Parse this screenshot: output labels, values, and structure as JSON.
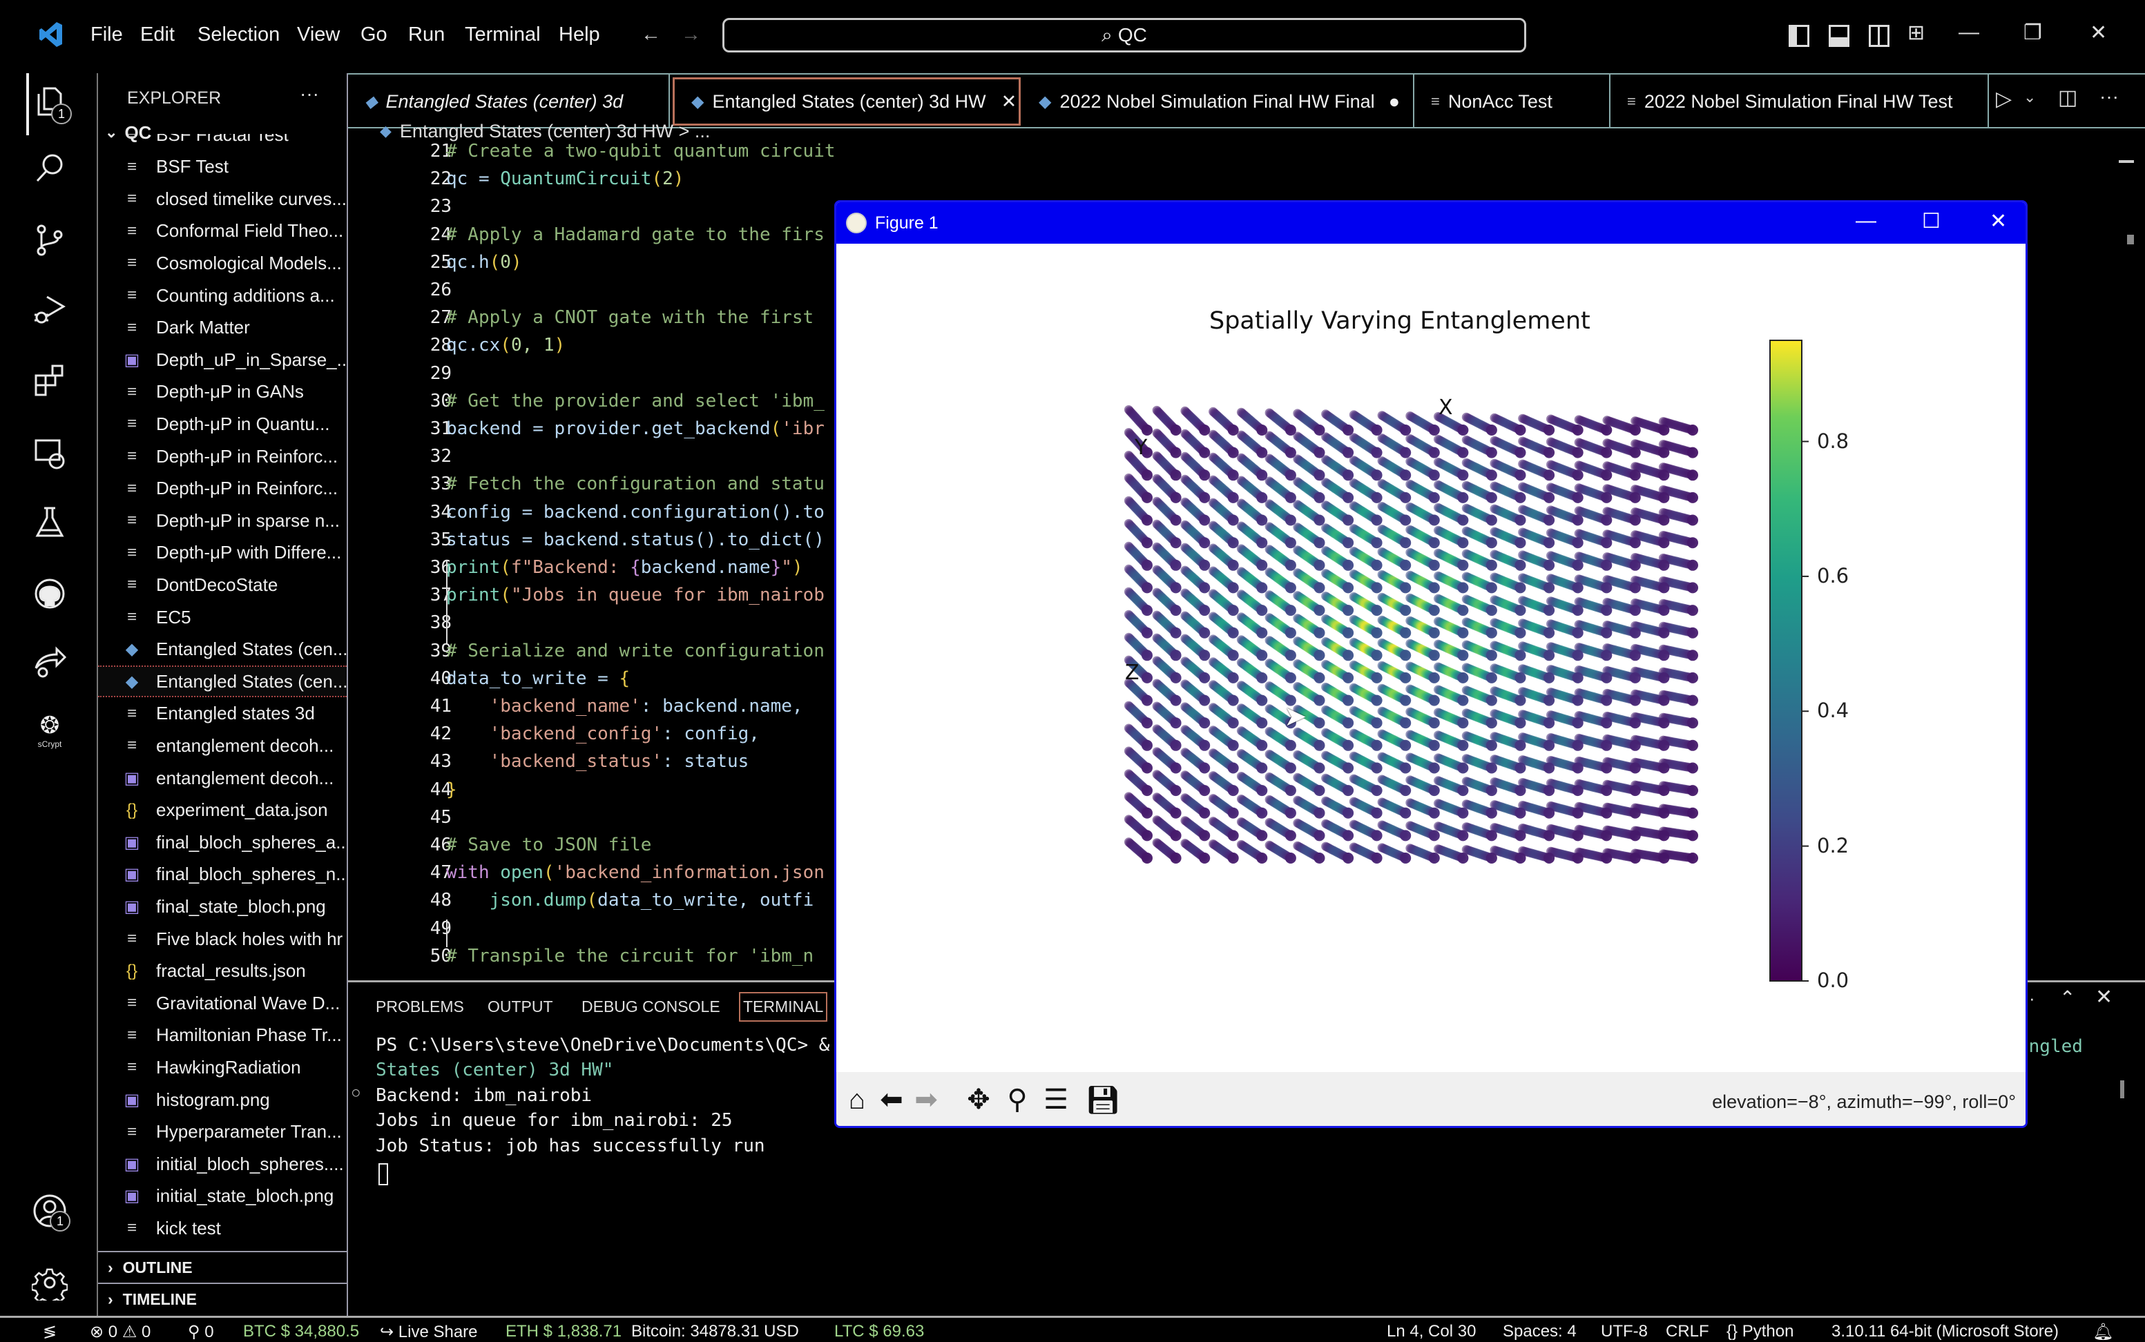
{
  "titlebar": {
    "menu": [
      "File",
      "Edit",
      "Selection",
      "View",
      "Go",
      "Run",
      "Terminal",
      "Help"
    ],
    "search": "QC",
    "back_icon": "arrow-left-icon",
    "forward_icon": "arrow-right-icon"
  },
  "activity_bar": {
    "items": [
      {
        "name": "explorer",
        "icon": "files-icon",
        "badge": "1"
      },
      {
        "name": "search",
        "icon": "search-icon"
      },
      {
        "name": "source-control",
        "icon": "source-control-icon"
      },
      {
        "name": "run-debug",
        "icon": "debug-icon"
      },
      {
        "name": "extensions",
        "icon": "extensions-icon"
      },
      {
        "name": "remote-explorer",
        "icon": "remote-icon"
      },
      {
        "name": "testing",
        "icon": "flask-icon"
      },
      {
        "name": "github",
        "icon": "github-icon"
      },
      {
        "name": "live-share",
        "icon": "share-icon"
      },
      {
        "name": "scrypt",
        "icon": "scrypt-icon",
        "label": "sCrypt"
      }
    ],
    "accounts_badge": "1"
  },
  "sidebar": {
    "title": "EXPLORER",
    "more": "···",
    "folder": "QC",
    "files": [
      {
        "name": "BSF Fractal Test",
        "type": "text"
      },
      {
        "name": "BSF Test",
        "type": "text"
      },
      {
        "name": "closed timelike curves...",
        "type": "text"
      },
      {
        "name": "Conformal Field Theo...",
        "type": "text"
      },
      {
        "name": "Cosmological Models...",
        "type": "text"
      },
      {
        "name": "Counting additions a...",
        "type": "text"
      },
      {
        "name": "Dark Matter",
        "type": "text"
      },
      {
        "name": "Depth_uP_in_Sparse_...",
        "type": "image"
      },
      {
        "name": "Depth-μP in GANs",
        "type": "text"
      },
      {
        "name": "Depth-μP in Quantu...",
        "type": "text"
      },
      {
        "name": "Depth-μP in Reinforc...",
        "type": "text"
      },
      {
        "name": "Depth-μP in Reinforc...",
        "type": "text"
      },
      {
        "name": "Depth-μP in sparse n...",
        "type": "text"
      },
      {
        "name": "Depth-μP with Differe...",
        "type": "text"
      },
      {
        "name": "DontDecoState",
        "type": "text"
      },
      {
        "name": "EC5",
        "type": "text"
      },
      {
        "name": "Entangled States (cen...",
        "type": "python"
      },
      {
        "name": "Entangled States (cen...",
        "type": "python",
        "selected": true
      },
      {
        "name": "Entangled states 3d",
        "type": "text"
      },
      {
        "name": "entanglement decoh...",
        "type": "text"
      },
      {
        "name": "entanglement decoh...",
        "type": "image"
      },
      {
        "name": "experiment_data.json",
        "type": "json"
      },
      {
        "name": "final_bloch_spheres_a...",
        "type": "image"
      },
      {
        "name": "final_bloch_spheres_n...",
        "type": "image"
      },
      {
        "name": "final_state_bloch.png",
        "type": "image"
      },
      {
        "name": "Five black holes with hr",
        "type": "text"
      },
      {
        "name": "fractal_results.json",
        "type": "json"
      },
      {
        "name": "Gravitational Wave D...",
        "type": "text"
      },
      {
        "name": "Hamiltonian Phase Tr...",
        "type": "text"
      },
      {
        "name": "HawkingRadiation",
        "type": "text"
      },
      {
        "name": "histogram.png",
        "type": "image"
      },
      {
        "name": "Hyperparameter Tran...",
        "type": "text"
      },
      {
        "name": "initial_bloch_spheres....",
        "type": "image"
      },
      {
        "name": "initial_state_bloch.png",
        "type": "image"
      },
      {
        "name": "kick test",
        "type": "text"
      }
    ],
    "outline": "OUTLINE",
    "timeline": "TIMELINE"
  },
  "tabs": [
    {
      "label": "Entangled States (center) 3d",
      "icon": "python",
      "italic": true
    },
    {
      "label": "Entangled States (center) 3d HW",
      "icon": "python",
      "active": true,
      "close": "✕"
    },
    {
      "label": "2022 Nobel Simulation Final HW Final",
      "icon": "python",
      "dirty": "●"
    },
    {
      "label": "NonAcc Test",
      "icon": "text"
    },
    {
      "label": "2022 Nobel Simulation Final HW Test",
      "icon": "text"
    }
  ],
  "breadcrumb": "Entangled States (center) 3d HW > ...",
  "code": [
    {
      "n": "21",
      "parts": [
        [
          "c-com",
          "# Create a two-qubit quantum circuit"
        ]
      ]
    },
    {
      "n": "22",
      "parts": [
        [
          "c-var",
          "qc = "
        ],
        [
          "c-fn",
          "QuantumCircuit"
        ],
        [
          "c-par",
          "("
        ],
        [
          "c-num",
          "2"
        ],
        [
          "c-par",
          ")"
        ]
      ]
    },
    {
      "n": "23",
      "parts": []
    },
    {
      "n": "24",
      "parts": [
        [
          "c-com",
          "# Apply a Hadamard gate to the firs"
        ]
      ]
    },
    {
      "n": "25",
      "parts": [
        [
          "c-var",
          "qc.h"
        ],
        [
          "c-par",
          "("
        ],
        [
          "c-num",
          "0"
        ],
        [
          "c-par",
          ")"
        ]
      ]
    },
    {
      "n": "26",
      "parts": []
    },
    {
      "n": "27",
      "parts": [
        [
          "c-com",
          "# Apply a CNOT gate with the first "
        ]
      ]
    },
    {
      "n": "28",
      "parts": [
        [
          "c-var",
          "qc.cx"
        ],
        [
          "c-par",
          "("
        ],
        [
          "c-num",
          "0, 1"
        ],
        [
          "c-par",
          ")"
        ]
      ]
    },
    {
      "n": "29",
      "parts": []
    },
    {
      "n": "30",
      "parts": [
        [
          "c-com",
          "# Get the provider and select 'ibm_"
        ]
      ]
    },
    {
      "n": "31",
      "parts": [
        [
          "c-var",
          "backend = provider.get_backend"
        ],
        [
          "c-par",
          "("
        ],
        [
          "c-str",
          "'ibr"
        ]
      ]
    },
    {
      "n": "32",
      "parts": []
    },
    {
      "n": "33",
      "parts": [
        [
          "c-com",
          "# Fetch the configuration and statu"
        ]
      ]
    },
    {
      "n": "34",
      "parts": [
        [
          "c-var",
          "config = backend.configuration().to"
        ]
      ]
    },
    {
      "n": "35",
      "parts": [
        [
          "c-var",
          "status = backend.status().to_dict()"
        ]
      ]
    },
    {
      "n": "36",
      "parts": [
        [
          "c-fn",
          "print"
        ],
        [
          "c-par",
          "("
        ],
        [
          "c-str",
          "f\"Backend: "
        ],
        [
          "c-kw",
          "{"
        ],
        [
          "c-var",
          "backend.name"
        ],
        [
          "c-kw",
          "}"
        ],
        [
          "c-str",
          "\""
        ],
        [
          "c-par",
          ")"
        ]
      ]
    },
    {
      "n": "37",
      "parts": [
        [
          "c-fn",
          "print"
        ],
        [
          "c-par",
          "("
        ],
        [
          "c-str",
          "\"Jobs in queue for ibm_nairob"
        ]
      ]
    },
    {
      "n": "38",
      "parts": []
    },
    {
      "n": "39",
      "parts": [
        [
          "c-com",
          "# Serialize and write configuration"
        ]
      ]
    },
    {
      "n": "40",
      "parts": [
        [
          "c-var",
          "data_to_write = "
        ],
        [
          "c-par",
          "{"
        ]
      ]
    },
    {
      "n": "41",
      "parts": [
        [
          "c-var",
          "    "
        ],
        [
          "c-str",
          "'backend_name'"
        ],
        [
          "c-var",
          ": backend.name,"
        ]
      ]
    },
    {
      "n": "42",
      "parts": [
        [
          "c-var",
          "    "
        ],
        [
          "c-str",
          "'backend_config'"
        ],
        [
          "c-var",
          ": config,"
        ]
      ]
    },
    {
      "n": "43",
      "parts": [
        [
          "c-var",
          "    "
        ],
        [
          "c-str",
          "'backend_status'"
        ],
        [
          "c-var",
          ": status"
        ]
      ]
    },
    {
      "n": "44",
      "parts": [
        [
          "c-par",
          "}"
        ]
      ]
    },
    {
      "n": "45",
      "parts": []
    },
    {
      "n": "46",
      "parts": [
        [
          "c-com",
          "# Save to JSON file"
        ]
      ]
    },
    {
      "n": "47",
      "parts": [
        [
          "c-kw",
          "with "
        ],
        [
          "c-fn",
          "open"
        ],
        [
          "c-par",
          "("
        ],
        [
          "c-str",
          "'backend_information.json"
        ]
      ]
    },
    {
      "n": "48",
      "parts": [
        [
          "c-var",
          "    "
        ],
        [
          "c-fn",
          "json.dump"
        ],
        [
          "c-par",
          "("
        ],
        [
          "c-var",
          "data_to_write, outfi"
        ]
      ]
    },
    {
      "n": "49",
      "parts": []
    },
    {
      "n": "50",
      "parts": [
        [
          "c-com",
          "# Transpile the circuit for 'ibm_n"
        ]
      ]
    }
  ],
  "panel": {
    "tabs": [
      "PROBLEMS",
      "OUTPUT",
      "DEBUG CONSOLE",
      "TERMINAL"
    ],
    "active_tab": "TERMINAL",
    "terminal": [
      {
        "text": "PS C:\\Users\\steve\\OneDrive\\Documents\\QC> &",
        "color": "#eeeeee"
      },
      {
        "text": "States (center) 3d HW\"",
        "color": "#7fc8b0"
      },
      {
        "text": "Backend: ibm_nairobi",
        "color": "#eeeeee",
        "marker": "○"
      },
      {
        "text": "Jobs in queue for ibm_nairobi: 25",
        "color": "#eeeeee"
      },
      {
        "text": "Job Status: job has successfully run",
        "color": "#eeeeee"
      }
    ],
    "terminal_right_text": "angled"
  },
  "statusbar": {
    "remote": "≶",
    "errors": "0",
    "warnings": "0",
    "ports": "0",
    "btc": "BTC $ 34,880.5",
    "live_share": "Live Share",
    "eth": "ETH $ 1,838.71",
    "bitcoin": "Bitcoin: 34878.31 USD",
    "ltc": "LTC $ 69.63",
    "position": "Ln 4, Col 30",
    "spaces": "Spaces: 4",
    "encoding": "UTF-8",
    "eol": "CRLF",
    "language": "Python",
    "interpreter": "3.10.11 64-bit (Microsoft Store)"
  },
  "figure": {
    "window_title": "Figure 1",
    "coords": "elevation=−8°, azimuth=−99°, roll=0°",
    "toolbar": [
      "home",
      "back",
      "forward",
      "pan",
      "zoom",
      "configure",
      "save"
    ]
  },
  "chart_data": {
    "type": "scatter",
    "projection": "3d",
    "title": "Spatially Varying Entanglement",
    "xlabel": "X",
    "ylabel": "Y",
    "zlabel": "Z",
    "view": {
      "elevation": -8,
      "azimuth": -99,
      "roll": 0
    },
    "grid_shape": [
      20,
      20,
      20
    ],
    "value_description": "entanglement value on a 3D grid, peaking near center (~0.95) and falling off toward edges (~0.05)",
    "center_max": 0.95,
    "edge_min": 0.05,
    "colormap": "viridis",
    "colorbar": {
      "range": [
        0.0,
        0.95
      ],
      "ticks": [
        0.0,
        0.2,
        0.4,
        0.6,
        0.8
      ],
      "tick_labels": [
        "0.0",
        "0.2",
        "0.4",
        "0.6",
        "0.8"
      ]
    }
  }
}
